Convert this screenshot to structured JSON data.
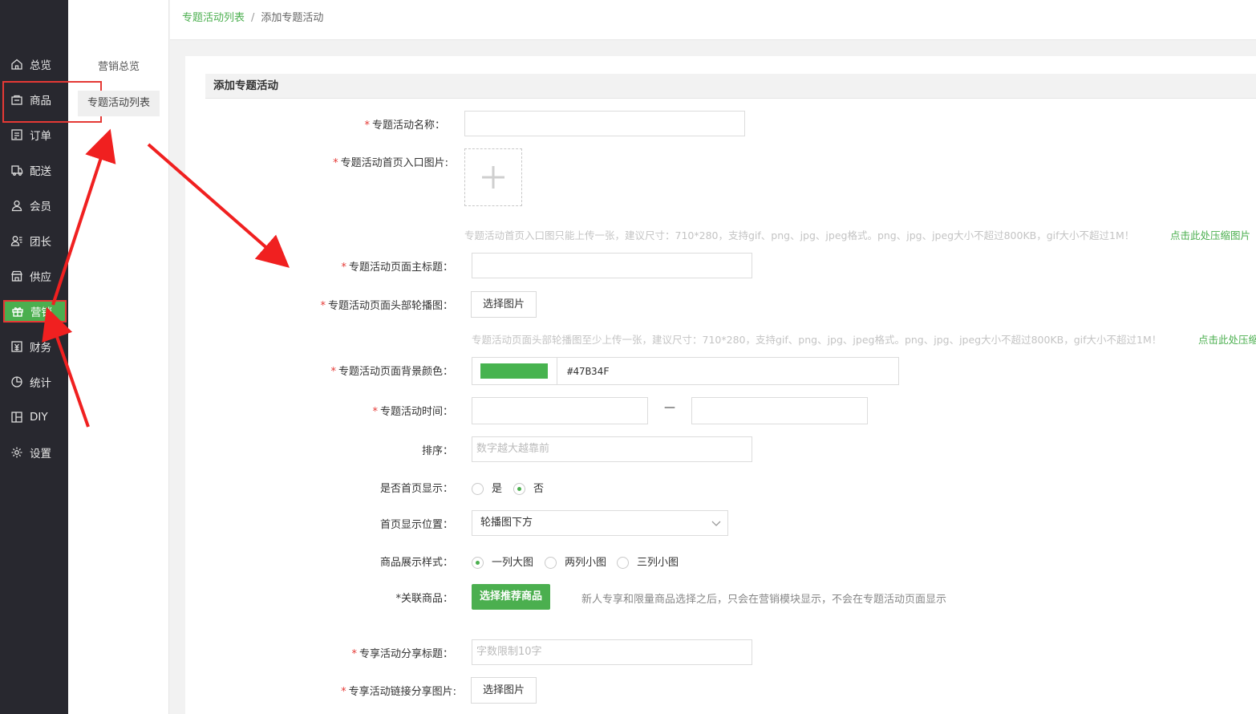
{
  "sidebar": {
    "items": [
      {
        "label": "总览",
        "icon": "home-icon"
      },
      {
        "label": "商品",
        "icon": "shop-bag-icon"
      },
      {
        "label": "订单",
        "icon": "order-icon"
      },
      {
        "label": "配送",
        "icon": "delivery-icon"
      },
      {
        "label": "会员",
        "icon": "user-icon"
      },
      {
        "label": "团长",
        "icon": "team-leader-icon"
      },
      {
        "label": "供应",
        "icon": "supply-store-icon"
      },
      {
        "label": "营销",
        "icon": "gift-icon",
        "active": true
      },
      {
        "label": "财务",
        "icon": "finance-icon"
      },
      {
        "label": "统计",
        "icon": "pie-chart-icon"
      },
      {
        "label": "DIY",
        "icon": "layout-icon"
      },
      {
        "label": "设置",
        "icon": "gear-icon"
      }
    ]
  },
  "submenu": {
    "overview": "营销总览",
    "list": "专题活动列表"
  },
  "breadcrumb": {
    "parent": "专题活动列表",
    "separator": "/",
    "current": "添加专题活动"
  },
  "form": {
    "title": "添加专题活动",
    "name_label": "专题活动名称：",
    "entry_image_label": "专题活动首页入口图片:",
    "entry_image_hint": "专题活动首页入口图只能上传一张，建议尺寸：710*280，支持gif、png、jpg、jpeg格式。png、jpg、jpeg大小不超过800KB，gif大小不超过1M！",
    "entry_image_link": "点击此处压缩图片",
    "main_title_label": "专题活动页面主标题：",
    "banner_label": "专题活动页面头部轮播图：",
    "select_image": "选择图片",
    "banner_hint": "专题活动页面头部轮播图至少上传一张，建议尺寸：710*280，支持gif、png、jpg、jpeg格式。png、jpg、jpeg大小不超过800KB，gif大小不超过1M！",
    "banner_link": "点击此处压缩",
    "bg_color_label": "专题活动页面背景颜色：",
    "bg_color_value": "#47B34F",
    "time_label": "专题活动时间：",
    "time_dash": "—",
    "sort_label": "排序：",
    "sort_placeholder": "数字越大越靠前",
    "home_show_label": "是否首页显示：",
    "home_show_yes": "是",
    "home_show_no": "否",
    "home_pos_label": "首页显示位置：",
    "home_pos_value": "轮播图下方",
    "goods_style_label": "商品展示样式：",
    "style_one": "一列大图",
    "style_two": "两列小图",
    "style_three": "三列小图",
    "related_goods_label": "*关联商品：",
    "select_goods_button": "选择推荐商品",
    "related_note": "新人专享和限量商品选择之后，只会在营销模块显示，不会在专题活动页面显示",
    "share_title_label": "专享活动分享标题：",
    "share_title_placeholder": "字数限制10字",
    "share_image_label": "专享活动链接分享图片:",
    "required_mark": "*"
  },
  "colors": {
    "accent": "#4baf4f",
    "sidebar_bg": "#28282f",
    "annotation": "#e53935"
  }
}
